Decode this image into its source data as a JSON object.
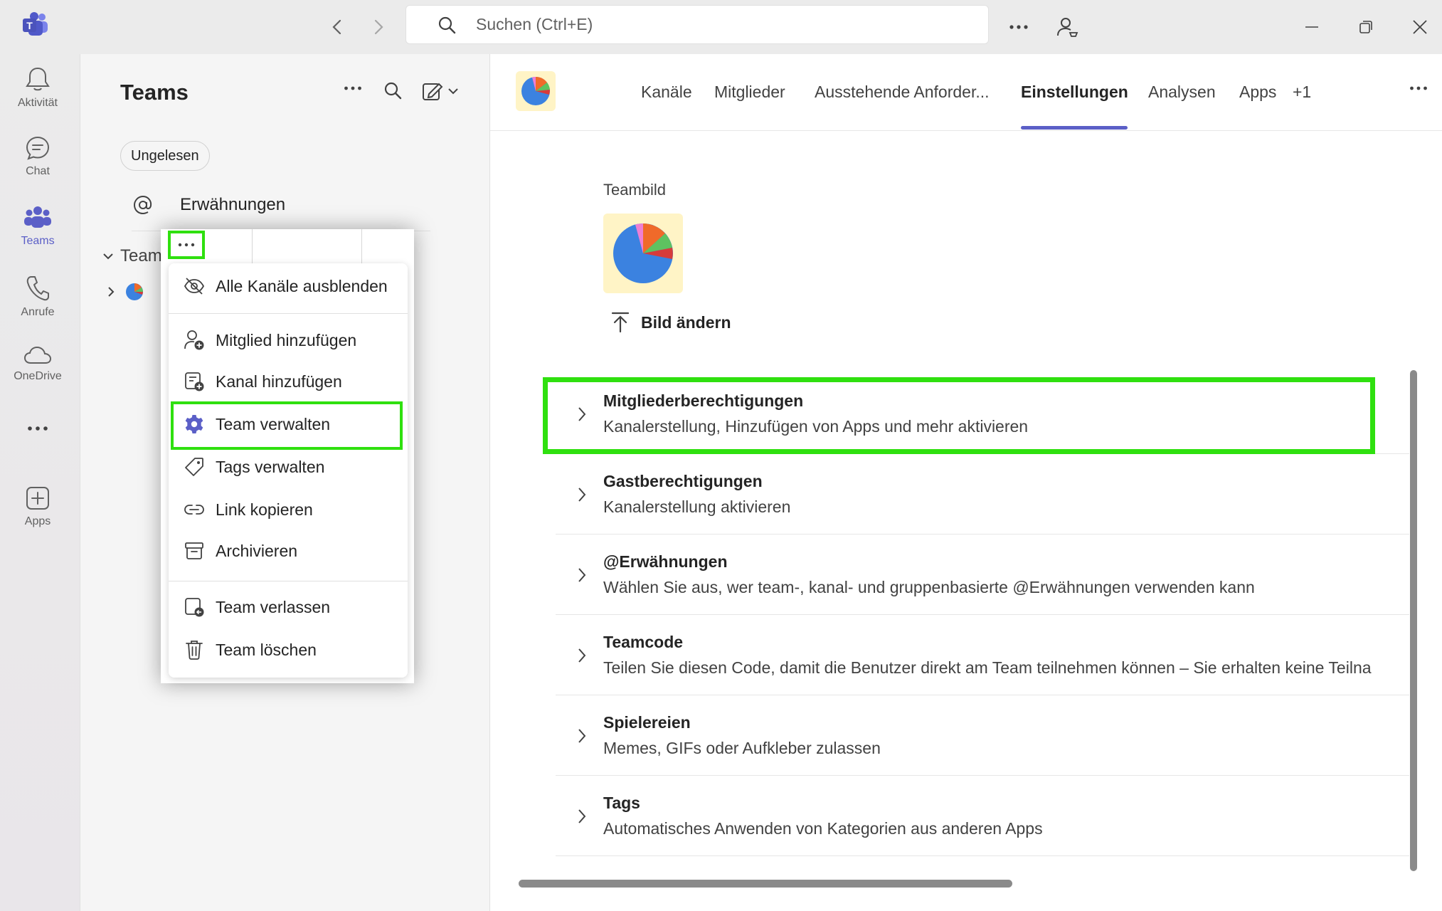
{
  "titlebar": {
    "search_placeholder": "Suchen (Ctrl+E)",
    "icons": [
      "teams-logo-icon",
      "back-icon",
      "forward-icon",
      "search-icon",
      "more-icon",
      "profile-icon",
      "minimize-icon",
      "restore-icon",
      "close-icon"
    ]
  },
  "rail": {
    "items": [
      {
        "label": "Aktivität",
        "icon": "bell-icon"
      },
      {
        "label": "Chat",
        "icon": "chat-icon"
      },
      {
        "label": "Teams",
        "icon": "teams-icon",
        "active": true
      },
      {
        "label": "Anrufe",
        "icon": "phone-icon"
      },
      {
        "label": "OneDrive",
        "icon": "cloud-icon"
      },
      {
        "label": "",
        "icon": "more-apps-icon"
      },
      {
        "label": "Apps",
        "icon": "add-apps-icon"
      }
    ]
  },
  "teams_panel": {
    "title": "Teams",
    "filter_chip": "Ungelesen",
    "mentions_label": "Erwähnungen",
    "section_label": "Team"
  },
  "context_menu": {
    "items": [
      {
        "label": "Alle Kanäle ausblenden",
        "icon": "eye-off-icon"
      },
      {
        "label": "Mitglied hinzufügen",
        "icon": "person-add-icon"
      },
      {
        "label": "Kanal hinzufügen",
        "icon": "channel-add-icon"
      },
      {
        "label": "Team verwalten",
        "icon": "gear-icon",
        "highlighted": true
      },
      {
        "label": "Tags verwalten",
        "icon": "tag-icon"
      },
      {
        "label": "Link kopieren",
        "icon": "link-icon"
      },
      {
        "label": "Archivieren",
        "icon": "archive-icon"
      },
      {
        "label": "Team verlassen",
        "icon": "leave-icon"
      },
      {
        "label": "Team löschen",
        "icon": "trash-icon"
      }
    ]
  },
  "content": {
    "tabs": [
      {
        "label": "Kanäle"
      },
      {
        "label": "Mitglieder"
      },
      {
        "label": "Ausstehende Anforder..."
      },
      {
        "label": "Einstellungen",
        "active": true
      },
      {
        "label": "Analysen"
      },
      {
        "label": "Apps"
      },
      {
        "label": "+1"
      }
    ],
    "teambild_label": "Teambild",
    "change_image_label": "Bild ändern",
    "settings": [
      {
        "title": "Mitgliederberechtigungen",
        "desc": "Kanalerstellung, Hinzufügen von Apps und mehr aktivieren"
      },
      {
        "title": "Gastberechtigungen",
        "desc": "Kanalerstellung aktivieren"
      },
      {
        "title": "@Erwähnungen",
        "desc": "Wählen Sie aus, wer team-, kanal- und gruppenbasierte @Erwähnungen verwenden kann"
      },
      {
        "title": "Teamcode",
        "desc": "Teilen Sie diesen Code, damit die Benutzer direkt am Team teilnehmen können – Sie erhalten keine Teilna"
      },
      {
        "title": "Spielereien",
        "desc": "Memes, GIFs oder Aufkleber zulassen"
      },
      {
        "title": "Tags",
        "desc": "Automatisches Anwenden von Kategorien aus anderen Apps"
      }
    ]
  },
  "colors": {
    "accent": "#5b5fc7",
    "highlight": "#2fe00f"
  }
}
